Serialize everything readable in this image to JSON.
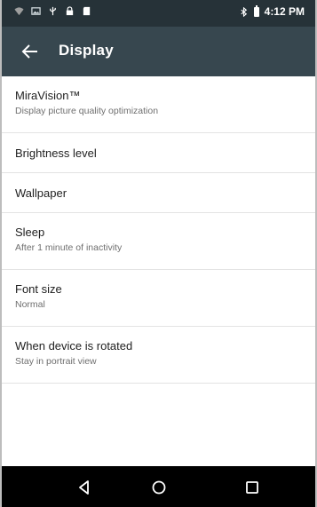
{
  "status_bar": {
    "time": "4:12 PM",
    "icons": [
      "wifi-icon",
      "image-icon",
      "usb-icon",
      "lock-icon",
      "sd-card-icon",
      "bluetooth-icon",
      "battery-icon"
    ]
  },
  "app_bar": {
    "title": "Display",
    "back_icon": "arrow-left-icon"
  },
  "settings": [
    {
      "title": "MiraVision™",
      "summary": "Display picture quality optimization"
    },
    {
      "title": "Brightness level",
      "summary": ""
    },
    {
      "title": "Wallpaper",
      "summary": ""
    },
    {
      "title": "Sleep",
      "summary": "After 1 minute of inactivity"
    },
    {
      "title": "Font size",
      "summary": "Normal"
    },
    {
      "title": "When device is rotated",
      "summary": "Stay in portrait view"
    }
  ],
  "nav_bar": {
    "icons": [
      "back-triangle-icon",
      "home-circle-icon",
      "recents-square-icon"
    ]
  },
  "colors": {
    "status_bar": "#263238",
    "app_bar": "#37474f",
    "nav_bar": "#000000"
  }
}
